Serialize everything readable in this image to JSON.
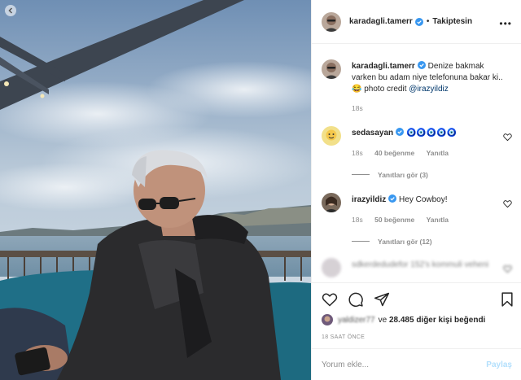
{
  "colors": {
    "verified": "#3897f0",
    "mention": "#00376b",
    "muted": "#8e8e8e",
    "post_disabled": "#b2dffc"
  },
  "photo": {
    "alt_icon": "chevron-left-icon"
  },
  "header": {
    "username": "karadagli.tamerr",
    "separator": "•",
    "follow_status": "Takiptesin",
    "more_icon": "more-horizontal-icon"
  },
  "caption": {
    "username": "karadagli.tamerr",
    "text": "Denize bakmak varken bu adam niye telefonuna bakar ki..😂 photo credit",
    "mention": "@irazyildiz",
    "age": "18s"
  },
  "comments": [
    {
      "username": "sedasayan",
      "text": "🧿🧿🧿🧿🧿",
      "age": "18s",
      "likes": "40 beğenme",
      "reply": "Yanıtla",
      "replies": "Yanıtları gör (3)"
    },
    {
      "username": "irazyildiz",
      "text": "Hey Cowboy!",
      "age": "18s",
      "likes": "50 beğenme",
      "reply": "Yanıtla",
      "replies": "Yanıtları gör (12)"
    }
  ],
  "blurred_comment": "sdkerdedudefor 152's kommuli veheni",
  "actions": {
    "icons": [
      "heart-icon",
      "comment-icon",
      "share-icon",
      "bookmark-icon"
    ]
  },
  "likes": {
    "blurred_user": "yaldizer77",
    "connector": "ve",
    "count": "28.485",
    "suffix": "diğer kişi beğendi"
  },
  "timestamp": "18 SAAT ÖNCE",
  "comment_box": {
    "placeholder": "Yorum ekle...",
    "post_label": "Paylaş"
  }
}
